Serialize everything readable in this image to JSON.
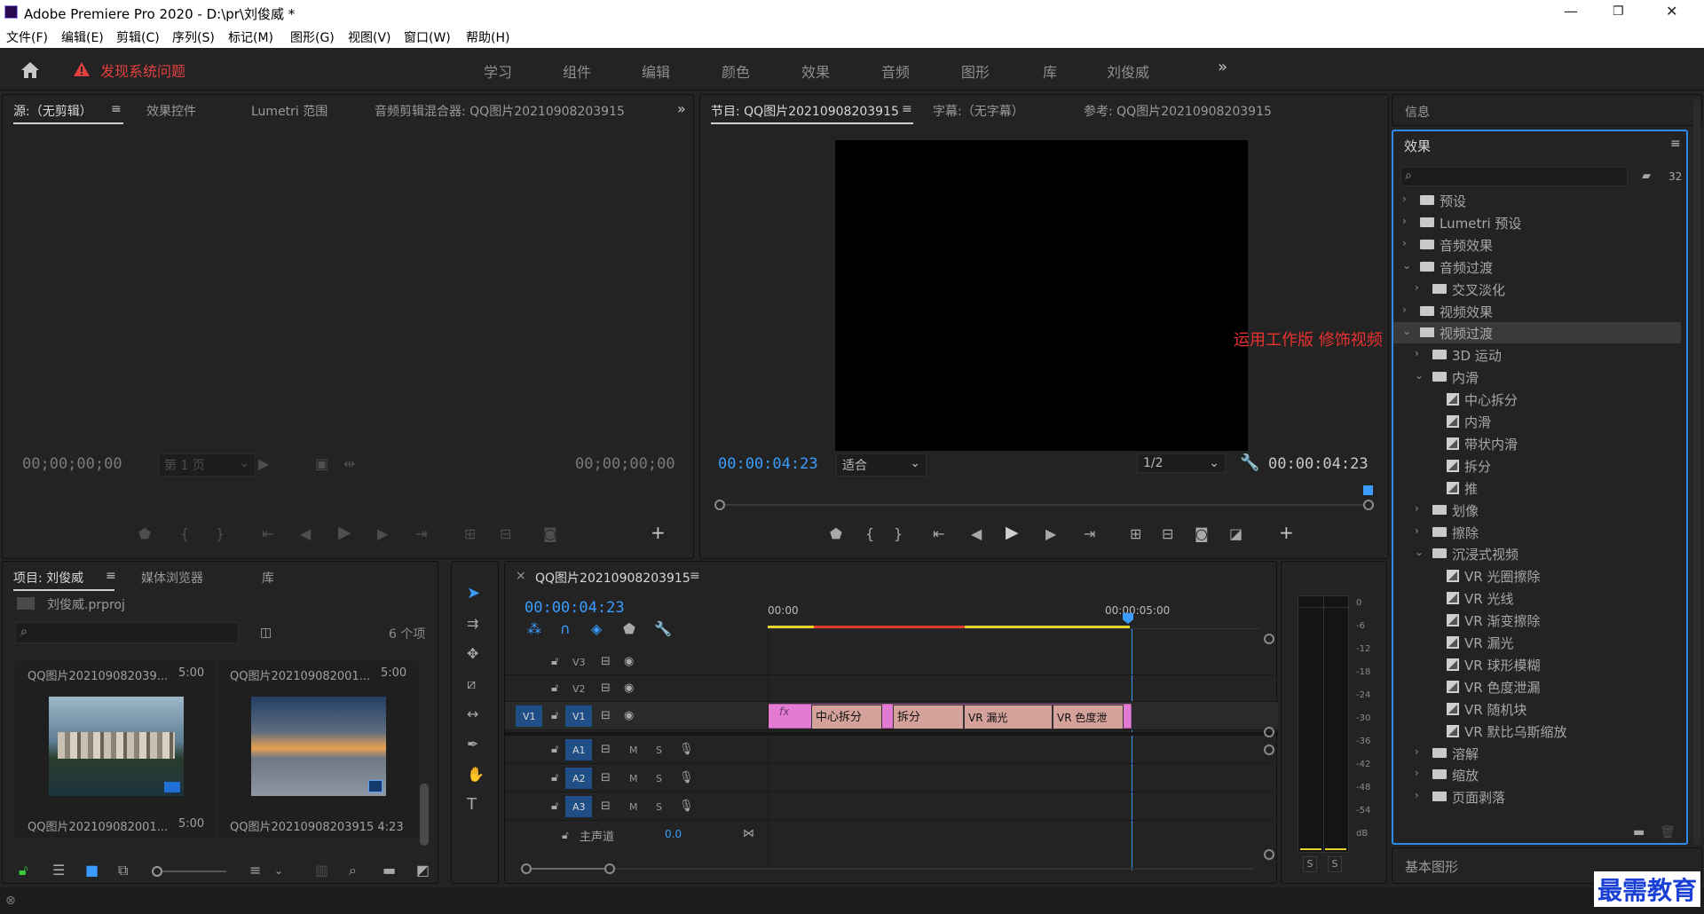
{
  "app": {
    "title": "Adobe Premiere Pro 2020 - D:\\pr\\刘俊威 *",
    "window_controls": [
      "minimize-icon",
      "maximize-icon",
      "close-icon"
    ]
  },
  "menu": [
    "文件(F)",
    "编辑(E)",
    "剪辑(C)",
    "序列(S)",
    "标记(M)",
    "图形(G)",
    "视图(V)",
    "窗口(W)",
    "帮助(H)"
  ],
  "workspace": {
    "alert": "发现系统问题",
    "tabs": [
      "学习",
      "组件",
      "编辑",
      "颜色",
      "效果",
      "音频",
      "图形",
      "库",
      "刘俊威"
    ],
    "more": "»"
  },
  "source_panel": {
    "tabs": [
      "源:（无剪辑）",
      "效果控件",
      "Lumetri 范围",
      "音频剪辑混合器: QQ图片20210908203915"
    ],
    "menu_glyph": "≡",
    "timecode_left": "00;00;00;00",
    "timecode_right": "00;00;00;00",
    "page_select": "第 1 页",
    "more": "»"
  },
  "program_panel": {
    "tabs": [
      "节目: QQ图片20210908203915",
      "字幕:（无字幕）",
      "参考: QQ图片20210908203915"
    ],
    "menu_glyph": "≡",
    "timecode_left": "00:00:04:23",
    "timecode_right": "00:00:04:23",
    "fit": "适合",
    "resolution": "1/2",
    "annotation": "运用工作版   修饰视频"
  },
  "project_panel": {
    "tabs": [
      "项目: 刘俊威",
      "媒体浏览器",
      "库"
    ],
    "menu_glyph": "≡",
    "file": "刘俊威.prproj",
    "count": "6 个项",
    "items": [
      {
        "name": "QQ图片202109082039...",
        "dur": "5:00"
      },
      {
        "name": "QQ图片202109082001...",
        "dur": "5:00"
      },
      {
        "name": "QQ图片202109082001...",
        "dur": "5:00"
      },
      {
        "name": "QQ图片20210908203915",
        "dur": "4:23"
      }
    ]
  },
  "timeline": {
    "close_glyph": "×",
    "tab": "QQ图片20210908203915",
    "menu_glyph": "≡",
    "timecode": "00:00:04:23",
    "ruler": [
      "00:00",
      "00:00:05:00"
    ],
    "video_tracks": [
      "V3",
      "V2",
      "V1"
    ],
    "source_patch": "V1",
    "audio_tracks": [
      "A1",
      "A2",
      "A3"
    ],
    "audio_ms": [
      "M",
      "S"
    ],
    "master": {
      "label": "主声道",
      "value": "0.0"
    },
    "clip": {
      "fx": "fx",
      "segments": [
        "中心拆分",
        "拆分",
        "VR 漏光",
        "VR 色度泄"
      ]
    }
  },
  "meter": {
    "scale": [
      "0",
      "-6",
      "-12",
      "-18",
      "-24",
      "-30",
      "-36",
      "-42",
      "-48",
      "-54",
      "dB"
    ],
    "solo": [
      "S",
      "S"
    ]
  },
  "effects_panel": {
    "info_tab": "信息",
    "title": "效果",
    "menu_glyph": "≡",
    "search_placeholder": "",
    "rows": [
      {
        "label": "预设",
        "level": 0,
        "type": "folder",
        "open": false
      },
      {
        "label": "Lumetri 预设",
        "level": 0,
        "type": "folder",
        "open": false
      },
      {
        "label": "音频效果",
        "level": 0,
        "type": "folder",
        "open": false
      },
      {
        "label": "音频过渡",
        "level": 0,
        "type": "folder",
        "open": true
      },
      {
        "label": "交叉淡化",
        "level": 1,
        "type": "folder",
        "open": false
      },
      {
        "label": "视频效果",
        "level": 0,
        "type": "folder",
        "open": false
      },
      {
        "label": "视频过渡",
        "level": 0,
        "type": "folder",
        "open": true,
        "selected": true
      },
      {
        "label": "3D 运动",
        "level": 1,
        "type": "folder",
        "open": false
      },
      {
        "label": "内滑",
        "level": 1,
        "type": "folder",
        "open": true
      },
      {
        "label": "中心拆分",
        "level": 2,
        "type": "item"
      },
      {
        "label": "内滑",
        "level": 2,
        "type": "item"
      },
      {
        "label": "带状内滑",
        "level": 2,
        "type": "item"
      },
      {
        "label": "拆分",
        "level": 2,
        "type": "item"
      },
      {
        "label": "推",
        "level": 2,
        "type": "item"
      },
      {
        "label": "划像",
        "level": 1,
        "type": "folder",
        "open": false
      },
      {
        "label": "擦除",
        "level": 1,
        "type": "folder",
        "open": false
      },
      {
        "label": "沉浸式视频",
        "level": 1,
        "type": "folder",
        "open": true
      },
      {
        "label": "VR 光圈擦除",
        "level": 2,
        "type": "item"
      },
      {
        "label": "VR 光线",
        "level": 2,
        "type": "item"
      },
      {
        "label": "VR 渐变擦除",
        "level": 2,
        "type": "item"
      },
      {
        "label": "VR 漏光",
        "level": 2,
        "type": "item"
      },
      {
        "label": "VR 球形模糊",
        "level": 2,
        "type": "item"
      },
      {
        "label": "VR 色度泄漏",
        "level": 2,
        "type": "item"
      },
      {
        "label": "VR 随机块",
        "level": 2,
        "type": "item"
      },
      {
        "label": "VR 默比乌斯缩放",
        "level": 2,
        "type": "item"
      },
      {
        "label": "溶解",
        "level": 1,
        "type": "folder",
        "open": false
      },
      {
        "label": "缩放",
        "level": 1,
        "type": "folder",
        "open": false
      },
      {
        "label": "页面剥落",
        "level": 1,
        "type": "folder",
        "open": false
      }
    ],
    "bottom_tab": "基本图形"
  },
  "watermark": "最需教育",
  "colors": {
    "accent_blue": "#3a9cff",
    "alert_red": "#e34040",
    "clip_pink": "#e47bd2",
    "annotation_red": "#e8322f"
  }
}
